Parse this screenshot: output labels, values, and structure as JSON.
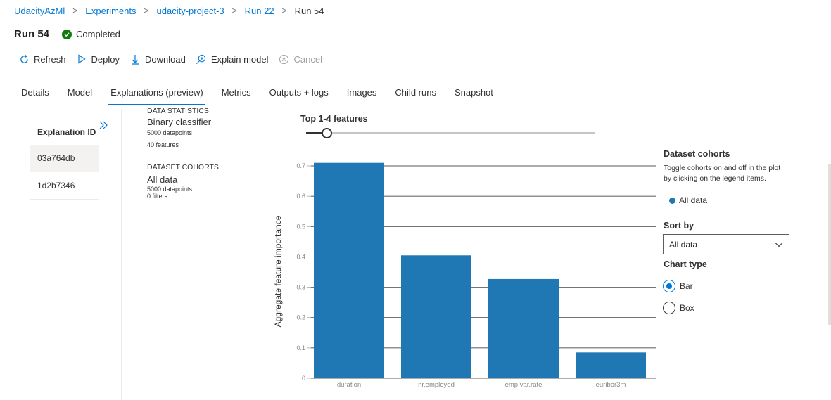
{
  "breadcrumb": [
    "UdacityAzMl",
    "Experiments",
    "udacity-project-3",
    "Run 22",
    "Run 54"
  ],
  "run": {
    "title": "Run 54",
    "status": "Completed"
  },
  "toolbar": {
    "refresh": "Refresh",
    "deploy": "Deploy",
    "download": "Download",
    "explain": "Explain model",
    "cancel": "Cancel"
  },
  "tabs": [
    "Details",
    "Model",
    "Explanations (preview)",
    "Metrics",
    "Outputs + logs",
    "Images",
    "Child runs",
    "Snapshot"
  ],
  "explanations": {
    "header": "Explanation ID",
    "ids": [
      "03a764db",
      "1d2b7346"
    ]
  },
  "data_statistics": {
    "heading": "DATA STATISTICS",
    "classifier": "Binary classifier",
    "datapoints": "5000 datapoints",
    "features": "40 features"
  },
  "dataset_cohorts_stats": {
    "heading": "DATASET COHORTS",
    "name": "All data",
    "datapoints": "5000 datapoints",
    "filters": "0 filters"
  },
  "feature_slider": {
    "label": "Top 1-4 features",
    "value_fraction": 0.07
  },
  "side": {
    "cohorts_title": "Dataset cohorts",
    "cohorts_desc_1": "Toggle cohorts on and off in the plot",
    "cohorts_desc_2": "by clicking on the legend items.",
    "legend_label": "All data",
    "sort_title": "Sort by",
    "sort_value": "All data",
    "chart_type_title": "Chart type",
    "option_bar": "Bar",
    "option_box": "Box"
  },
  "colors": {
    "accent": "#0078d4",
    "bar": "#1f77b4",
    "success": "#107c10"
  },
  "chart_data": {
    "type": "bar",
    "categories": [
      "duration",
      "nr.employed",
      "emp.var.rate",
      "euribor3m"
    ],
    "values": [
      0.71,
      0.405,
      0.327,
      0.085
    ],
    "ylabel": "Aggregate feature importance",
    "xlabel": "",
    "ylim": [
      0,
      0.7
    ],
    "yticks": [
      "0",
      "0.1",
      "0.2",
      "0.3",
      "0.4",
      "0.5",
      "0.6",
      "0.7"
    ],
    "grid": true
  }
}
